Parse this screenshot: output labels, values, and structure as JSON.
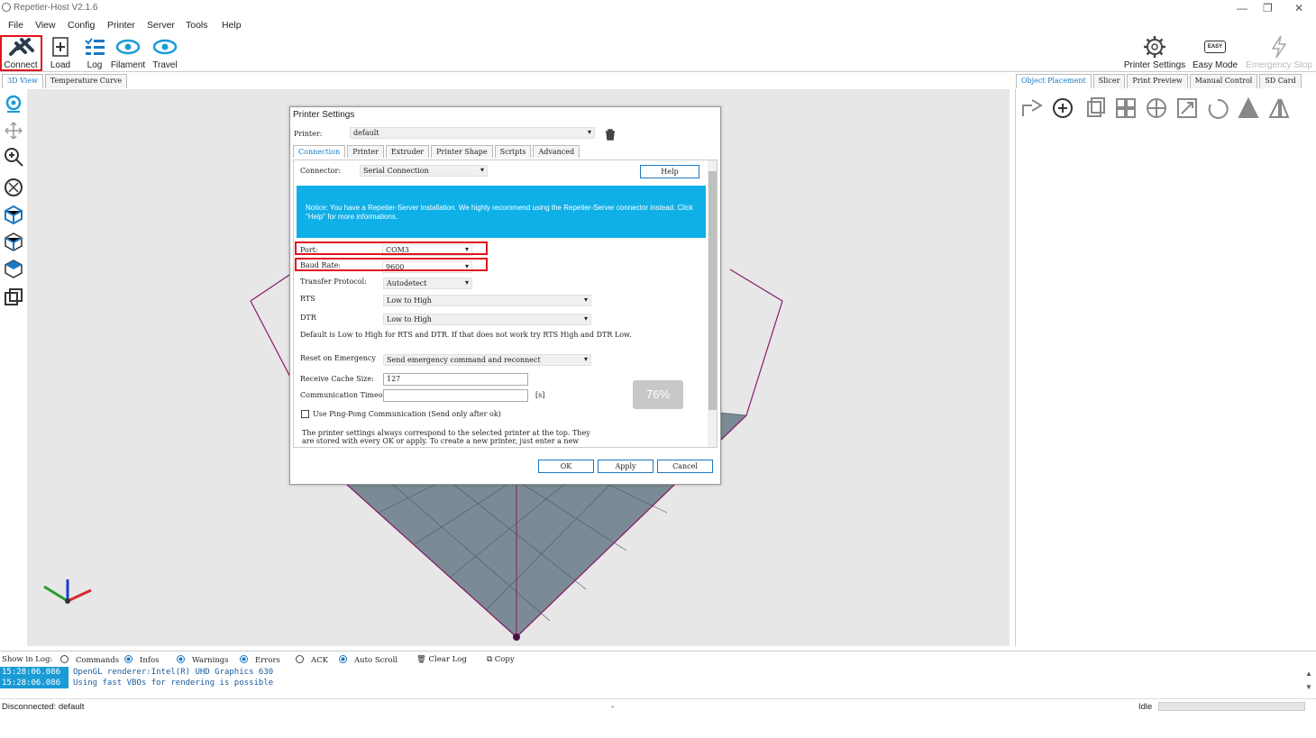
{
  "app": {
    "title": "Repetier-Host V2.1.6"
  },
  "menu": [
    "File",
    "View",
    "Config",
    "Printer",
    "Server",
    "Tools",
    "Help"
  ],
  "toolbar": {
    "connect": "Connect",
    "load": "Load",
    "log": "Log",
    "filament": "Filament",
    "travel": "Travel",
    "printer_settings": "Printer Settings",
    "easy_mode": "Easy Mode",
    "emergency_stop": "Emergency Stop",
    "easy_badge": "EASY"
  },
  "left_tabs": [
    "3D View",
    "Temperature Curve"
  ],
  "right_tabs": [
    "Object Placement",
    "Slicer",
    "Print Preview",
    "Manual Control",
    "SD Card"
  ],
  "dialog": {
    "title": "Printer Settings",
    "printer_label": "Printer:",
    "printer_value": "default",
    "tabs": [
      "Connection",
      "Printer",
      "Extruder",
      "Printer Shape",
      "Scripts",
      "Advanced"
    ],
    "connector_label": "Connector:",
    "connector_value": "Serial Connection",
    "help_button": "Help",
    "notice": "Notice: You have a Repetier-Server installation. We highly recommend using the Repetier-Server connector instead. Click \"Help\" for more informations.",
    "port_label": "Port:",
    "port_value": "COM3",
    "baud_label": "Baud Rate:",
    "baud_value": "9600",
    "transfer_label": "Transfer Protocol:",
    "transfer_value": "Autodetect",
    "rts_label": "RTS",
    "rts_value": "Low to High",
    "dtr_label": "DTR",
    "dtr_value": "Low to High",
    "default_note": "Default is Low to High for RTS and DTR. If that does not work try RTS High and DTR Low.",
    "reset_label": "Reset on Emergency",
    "reset_value": "Send emergency command and reconnect",
    "cache_label": "Receive Cache Size:",
    "cache_value": "127",
    "timeout_label": "Communication Timeout:",
    "timeout_value": "",
    "timeout_unit": "[s]",
    "zoom_badge": "76%",
    "pingpong_label": "Use Ping-Pong Communication (Send only after ok)",
    "footer_note_1": "The printer settings always correspond to the selected printer at the top. They",
    "footer_note_2": "are stored with every OK or apply. To create a new printer, just enter a new",
    "ok_button": "OK",
    "apply_button": "Apply",
    "cancel_button": "Cancel"
  },
  "log": {
    "show_label": "Show in Log:",
    "filters": [
      "Commands",
      "Infos",
      "Warnings",
      "Errors",
      "ACK",
      "Auto Scroll"
    ],
    "clear_label": "Clear Log",
    "copy_label": "Copy",
    "rows": [
      {
        "time": "15:28:06.086",
        "msg": "OpenGL renderer:Intel(R) UHD Graphics 630"
      },
      {
        "time": "15:28:06.086",
        "msg": "Using fast VBOs for rendering is possible"
      }
    ]
  },
  "status": {
    "left": "Disconnected: default",
    "mid": "-",
    "right": "Idle"
  },
  "colors": {
    "accent": "#1a78c2",
    "notice_bg": "#0fb0e8",
    "highlight": "#e0141e",
    "bed": "#7b8b95"
  }
}
